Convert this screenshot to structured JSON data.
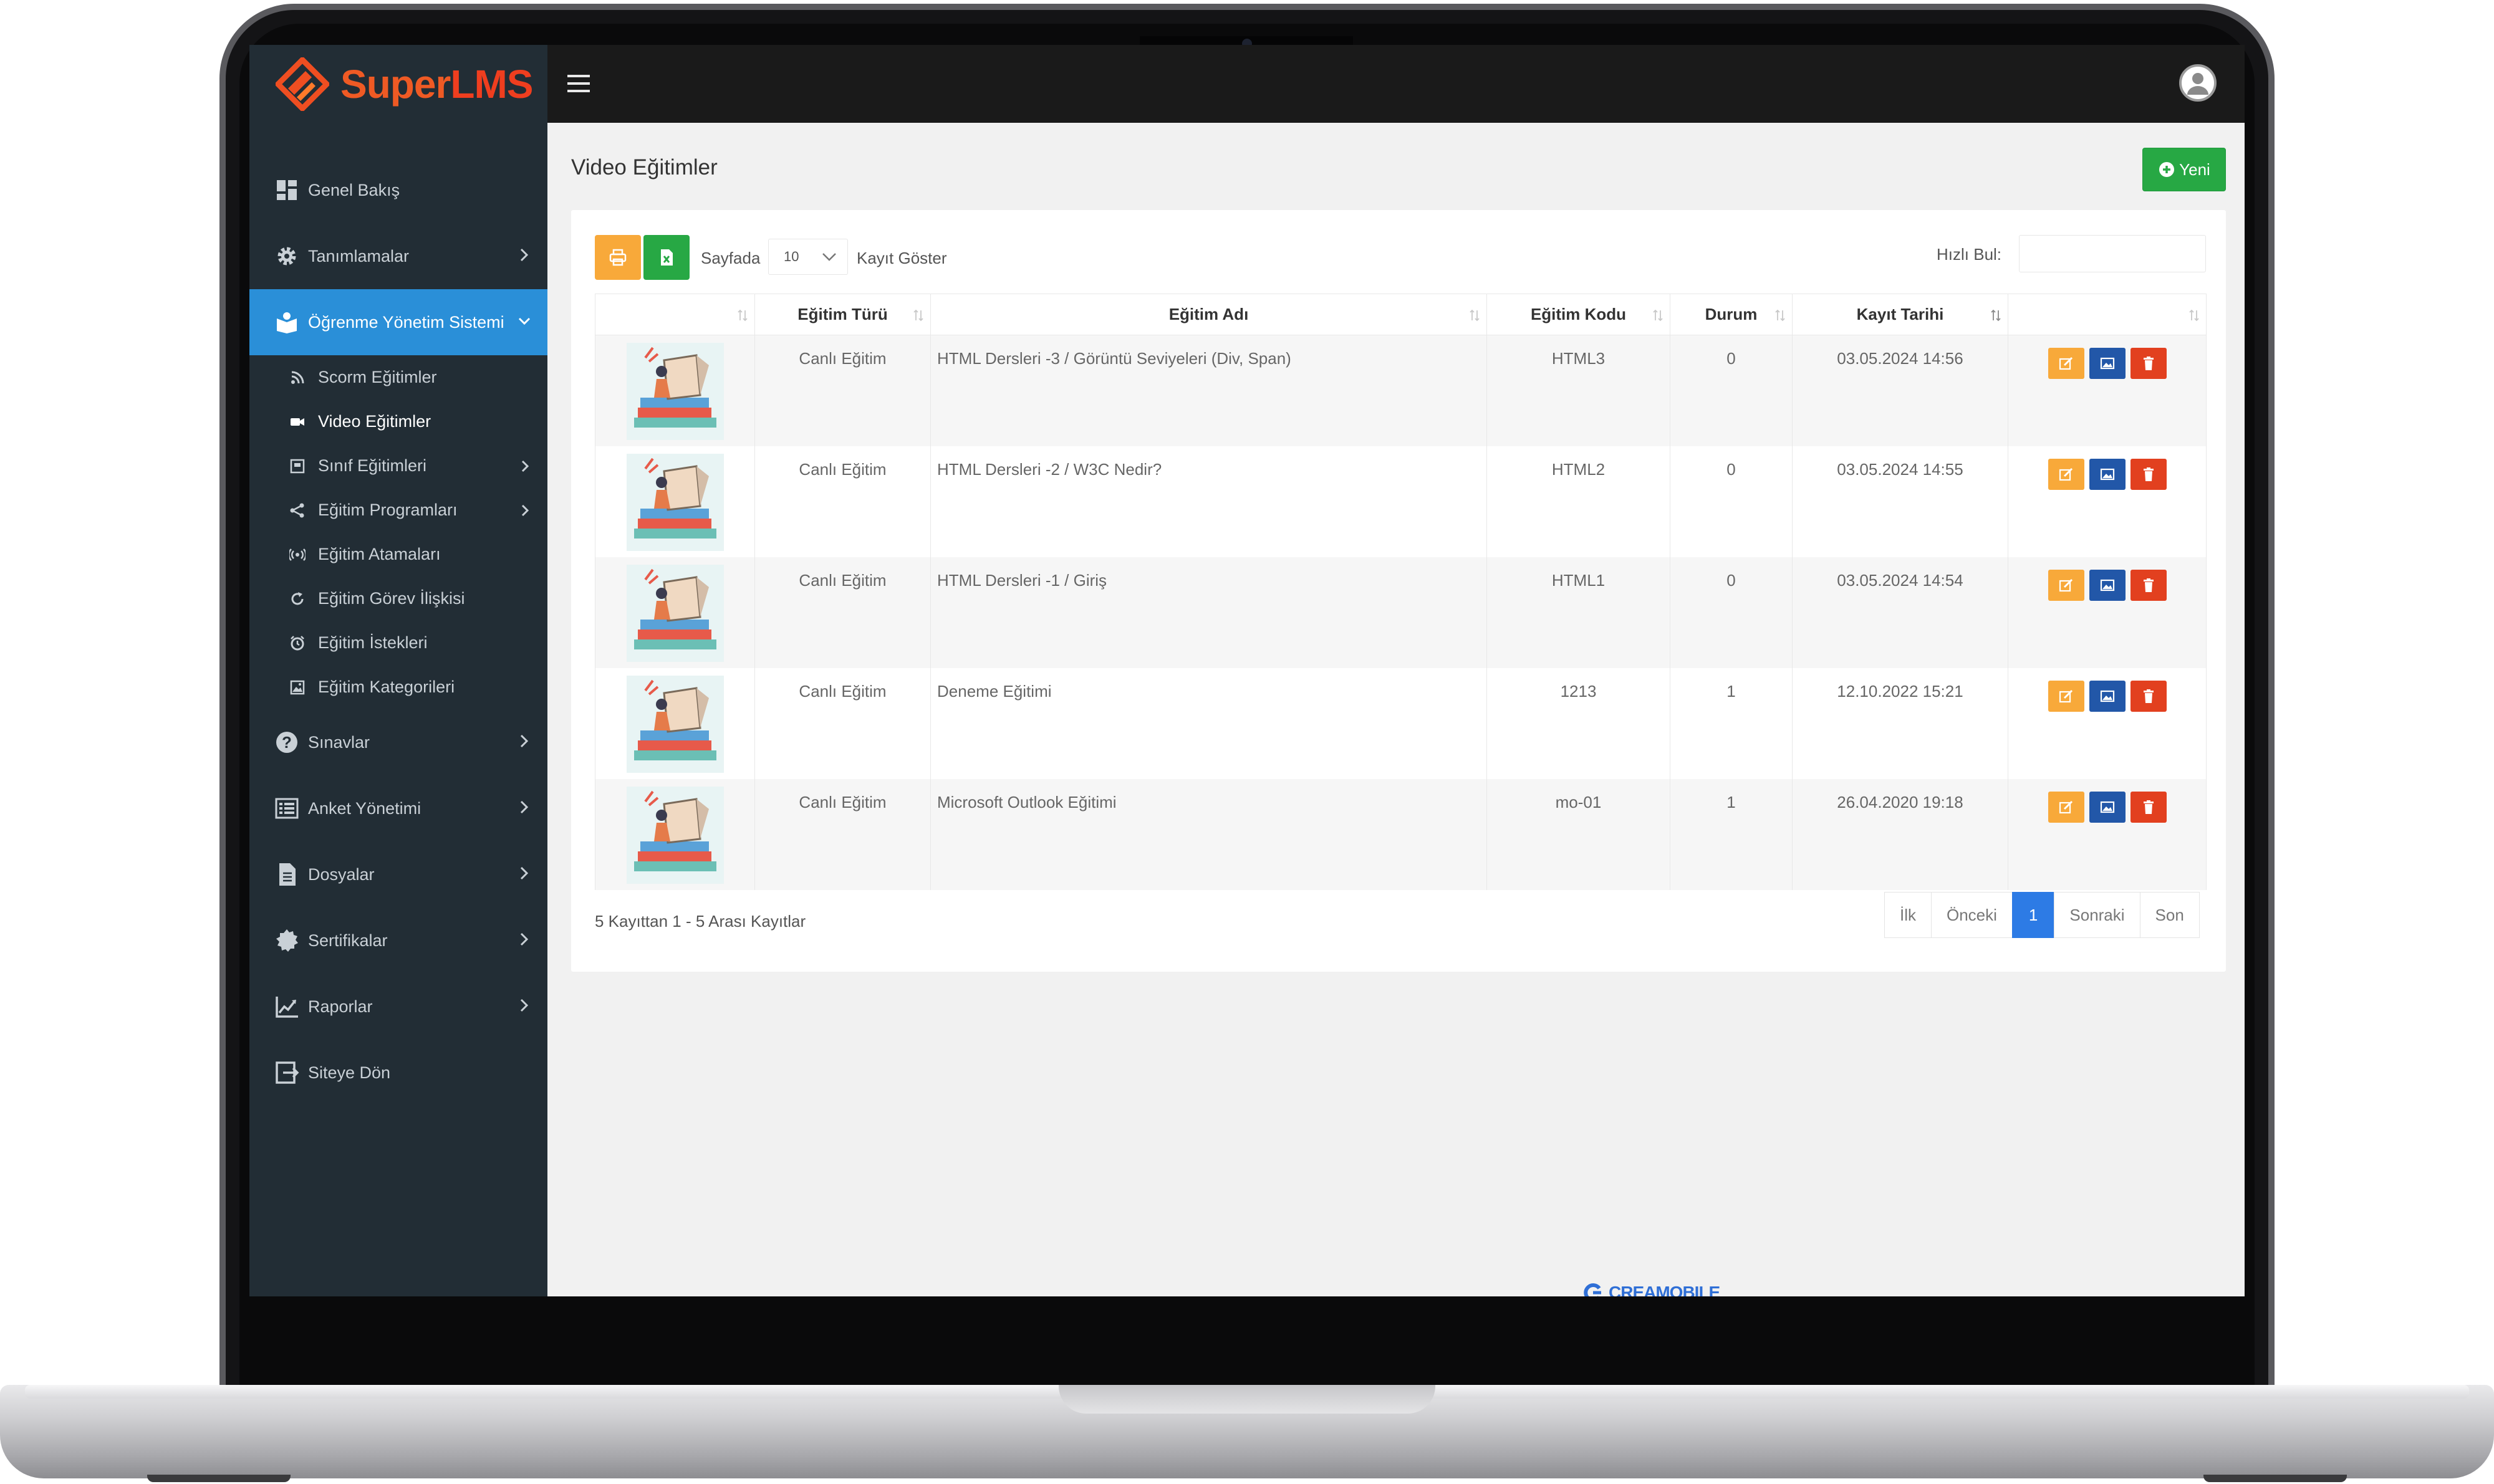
{
  "app": {
    "logo_part1": "Super",
    "logo_part2": "LMS"
  },
  "sidebar": {
    "items": [
      {
        "label": "Genel Bakış",
        "icon": "dashboard-icon"
      },
      {
        "label": "Tanımlamalar",
        "icon": "gear-icon"
      },
      {
        "label": "Öğrenme Yönetim Sistemi",
        "icon": "book-icon",
        "active": true
      },
      {
        "label": "Sınavlar",
        "icon": "question-icon"
      },
      {
        "label": "Anket Yönetimi",
        "icon": "list-icon"
      },
      {
        "label": "Dosyalar",
        "icon": "file-icon"
      },
      {
        "label": "Sertifikalar",
        "icon": "badge-icon"
      },
      {
        "label": "Raporlar",
        "icon": "chart-icon"
      },
      {
        "label": "Siteye Dön",
        "icon": "exit-icon"
      }
    ],
    "subitems": [
      {
        "label": "Scorm Eğitimler"
      },
      {
        "label": "Video Eğitimler",
        "current": true
      },
      {
        "label": "Sınıf Eğitimleri"
      },
      {
        "label": "Eğitim Programları"
      },
      {
        "label": "Eğitim Atamaları"
      },
      {
        "label": "Eğitim Görev İlişkisi"
      },
      {
        "label": "Eğitim İstekleri"
      },
      {
        "label": "Eğitim Kategorileri"
      }
    ]
  },
  "page": {
    "title": "Video Eğitimler",
    "new_button": "Yeni"
  },
  "toolbar": {
    "per_page_label": "Sayfada",
    "per_page_value": "10",
    "show_label": "Kayıt Göster",
    "search_label": "Hızlı Bul:",
    "search_value": ""
  },
  "table": {
    "headers": [
      "",
      "Eğitim Türü",
      "Eğitim Adı",
      "Eğitim Kodu",
      "Durum",
      "Kayıt Tarihi",
      ""
    ],
    "rows": [
      {
        "type": "Canlı Eğitim",
        "name": "HTML Dersleri -3 / Görüntü Seviyeleri (Div, Span)",
        "code": "HTML3",
        "status": "0",
        "date": "03.05.2024 14:56"
      },
      {
        "type": "Canlı Eğitim",
        "name": "HTML Dersleri -2 / W3C Nedir?",
        "code": "HTML2",
        "status": "0",
        "date": "03.05.2024 14:55"
      },
      {
        "type": "Canlı Eğitim",
        "name": "HTML Dersleri -1 / Giriş",
        "code": "HTML1",
        "status": "0",
        "date": "03.05.2024 14:54"
      },
      {
        "type": "Canlı Eğitim",
        "name": "Deneme Eğitimi",
        "code": "1213",
        "status": "1",
        "date": "12.10.2022 15:21"
      },
      {
        "type": "Canlı Eğitim",
        "name": "Microsoft Outlook Eğitimi",
        "code": "mo-01",
        "status": "1",
        "date": "26.04.2020 19:18"
      }
    ]
  },
  "footer": {
    "info": "5 Kayıttan 1 - 5 Arası Kayıtlar",
    "pager": {
      "first": "İlk",
      "prev": "Önceki",
      "current": "1",
      "next": "Sonraki",
      "last": "Son"
    },
    "brand": "CREAMOBILE"
  },
  "colors": {
    "sidebar_bg": "#222d35",
    "active_nav": "#2a8fd8",
    "topbar_bg": "#1a1a1a",
    "new_button": "#27a844",
    "edit_button": "#f8a93a",
    "image_button": "#2257a8",
    "delete_button": "#e2401f",
    "pager_active": "#2d7be5"
  }
}
